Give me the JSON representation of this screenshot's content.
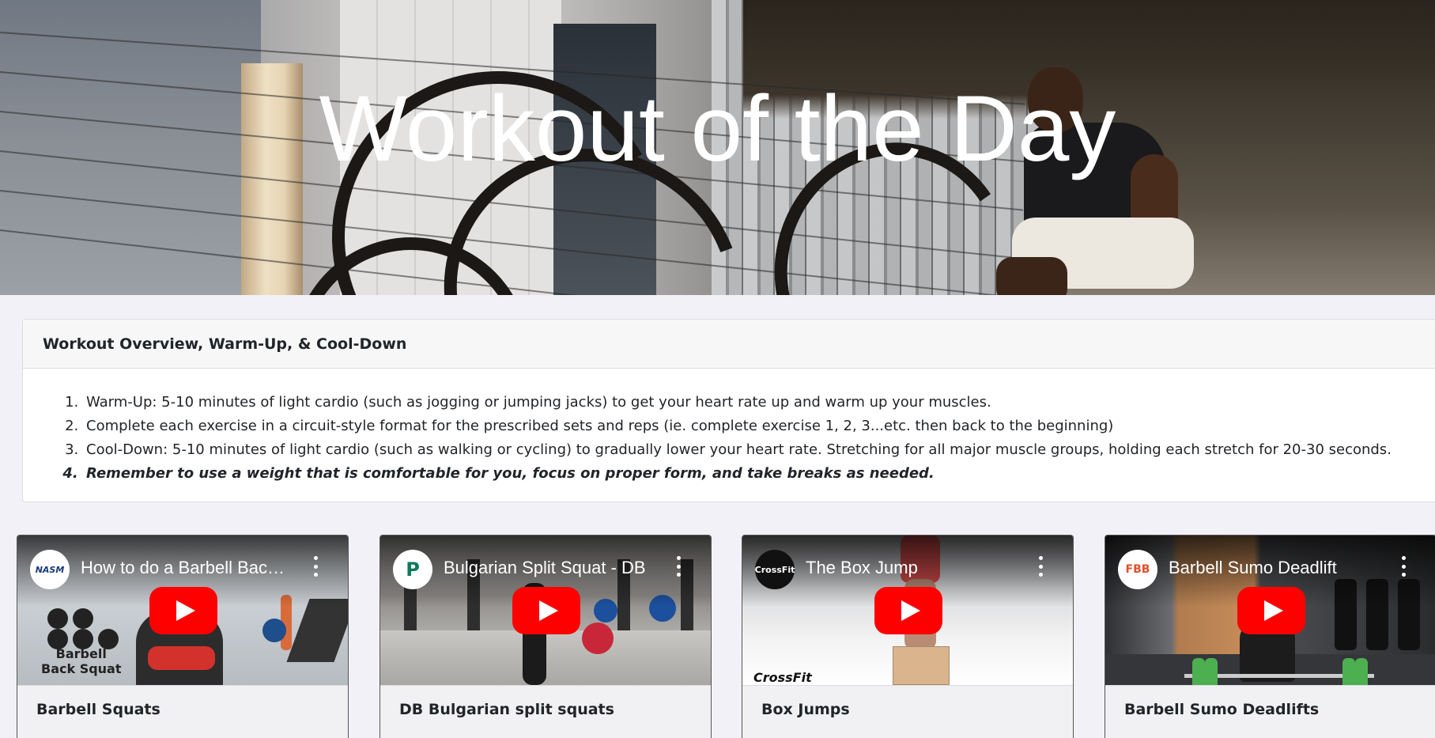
{
  "hero": {
    "title": "Workout of the Day"
  },
  "overview": {
    "heading": "Workout Overview, Warm-Up, & Cool-Down",
    "items": [
      "Warm-Up: 5-10 minutes of light cardio (such as jogging or jumping jacks) to get your heart rate up and warm up your muscles.",
      "Complete each exercise in a circuit-style format for the prescribed sets and reps (ie. complete exercise 1, 2, 3...etc. then back to the beginning)",
      "Cool-Down: 5-10 minutes of light cardio (such as walking or cycling) to gradually lower your heart rate. Stretching for all major muscle groups, holding each stretch for 20-30 seconds.",
      "Remember to use a weight that is comfortable for you, focus on proper form, and take breaks as needed."
    ]
  },
  "videos": [
    {
      "channel": "NASM",
      "video_title": "How to do a Barbell Back Squat",
      "thumb_caption": "Barbell\nBack Squat",
      "exercise": "Barbell Squats"
    },
    {
      "channel": "P",
      "video_title": "Bulgarian Split Squat - DB",
      "exercise": "DB Bulgarian split squats"
    },
    {
      "channel": "CrossFit",
      "video_title": "The Box Jump",
      "thumb_caption": "CrossFit",
      "exercise": "Box Jumps"
    },
    {
      "channel": "FBB",
      "video_title": "Barbell Sumo Deadlift",
      "exercise": "Barbell Sumo Deadlifts"
    }
  ],
  "colors": {
    "youtube_red": "#ff0000",
    "page_bg": "#f2f1f7"
  },
  "icons": {
    "play": "play-icon",
    "more": "more-vert-icon"
  }
}
